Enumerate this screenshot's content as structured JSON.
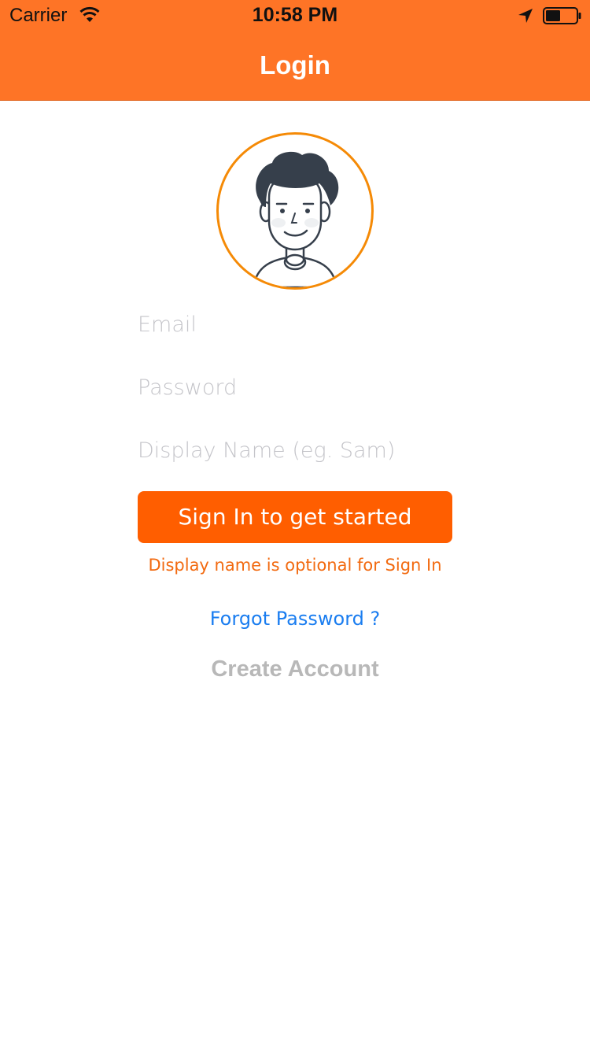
{
  "status_bar": {
    "carrier": "Carrier",
    "time": "10:58 PM",
    "icons": [
      "wifi-icon",
      "location-arrow-icon",
      "battery-icon"
    ]
  },
  "nav": {
    "title": "Login"
  },
  "avatar": {
    "icon": "user-avatar-illustration"
  },
  "form": {
    "email_placeholder": "Email",
    "password_placeholder": "Password",
    "display_name_placeholder": "Display Name (eg. Sam)",
    "signin_label": "Sign In to get started",
    "hint": "Display name is optional for Sign In",
    "forgot_label": "Forgot Password ?",
    "create_label": "Create Account"
  },
  "colors": {
    "header": "#fe7426",
    "button": "#ff5e00",
    "hint": "#f26a10",
    "link": "#1a7df0",
    "muted": "#b8b8b8",
    "avatar_ring": "#f58a06"
  }
}
